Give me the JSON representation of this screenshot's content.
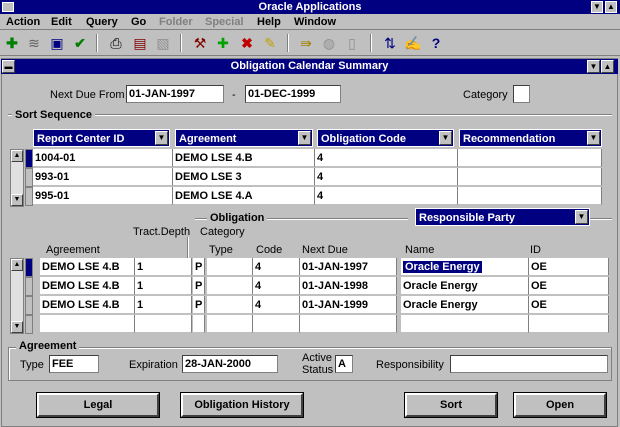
{
  "app": {
    "title": "Oracle Applications"
  },
  "menu": [
    "Action",
    "Edit",
    "Query",
    "Go",
    "Folder",
    "Special",
    "Help",
    "Window"
  ],
  "menu_disabled": [
    "Folder",
    "Special"
  ],
  "toolbar_icons": [
    "new-icon",
    "clear-icon",
    "save-icon",
    "accept-icon",
    "print-icon",
    "find-icon",
    "lov-icon",
    "close-icon",
    "add-icon",
    "delete-icon",
    "edit-icon",
    "zoom-icon",
    "world-icon",
    "attachment-icon",
    "folder-tools-icon",
    "edit-field-icon",
    "help-icon"
  ],
  "window": {
    "title": "Obligation Calendar Summary"
  },
  "header": {
    "next_due_from_label": "Next Due From",
    "next_due_from": "01-JAN-1997",
    "dash": "-",
    "next_due_to": "01-DEC-1999",
    "category_label": "Category",
    "category": ""
  },
  "sort": {
    "title": "Sort Sequence",
    "columns": [
      "Report Center ID",
      "Agreement",
      "Obligation Code",
      "Recommendation"
    ],
    "rows": [
      [
        "1004-01",
        "DEMO LSE 4.B",
        "4",
        ""
      ],
      [
        "993-01",
        "DEMO LSE 3",
        "4",
        ""
      ],
      [
        "995-01",
        "DEMO LSE 4.A",
        "4",
        ""
      ]
    ]
  },
  "obligation": {
    "section_title": "Obligation",
    "responsible_party_dropdown": "Responsible Party",
    "col_agreement": "Agreement",
    "col_tract_depth": "Tract.Depth",
    "col_category": "Category",
    "col_type": "Type",
    "col_code": "Code",
    "col_next_due": "Next Due",
    "col_name": "Name",
    "col_id": "ID",
    "rows": [
      {
        "agreement": "DEMO LSE 4.B",
        "tract_depth": "1",
        "category": "P",
        "type": "",
        "code": "4",
        "next_due": "01-JAN-1997",
        "name": "Oracle Energy",
        "id": "OE"
      },
      {
        "agreement": "DEMO LSE 4.B",
        "tract_depth": "1",
        "category": "P",
        "type": "",
        "code": "4",
        "next_due": "01-JAN-1998",
        "name": "Oracle Energy",
        "id": "OE"
      },
      {
        "agreement": "DEMO LSE 4.B",
        "tract_depth": "1",
        "category": "P",
        "type": "",
        "code": "4",
        "next_due": "01-JAN-1999",
        "name": "Oracle Energy",
        "id": "OE"
      },
      {
        "agreement": "",
        "tract_depth": "",
        "category": "",
        "type": "",
        "code": "",
        "next_due": "",
        "name": "",
        "id": ""
      }
    ]
  },
  "agreement": {
    "title": "Agreement",
    "type_label": "Type",
    "type": "FEE",
    "expiration_label": "Expiration",
    "expiration": "28-JAN-2000",
    "active_status_label_1": "Active",
    "active_status_label_2": "Status",
    "active_status": "A",
    "responsibility_label": "Responsibility",
    "responsibility": ""
  },
  "buttons": {
    "legal": "Legal",
    "obligation_history": "Obligation History",
    "sort": "Sort",
    "open": "Open"
  },
  "colors": {
    "title_bar": "#000080",
    "background": "#c0c0c0",
    "field": "#ffffff"
  }
}
